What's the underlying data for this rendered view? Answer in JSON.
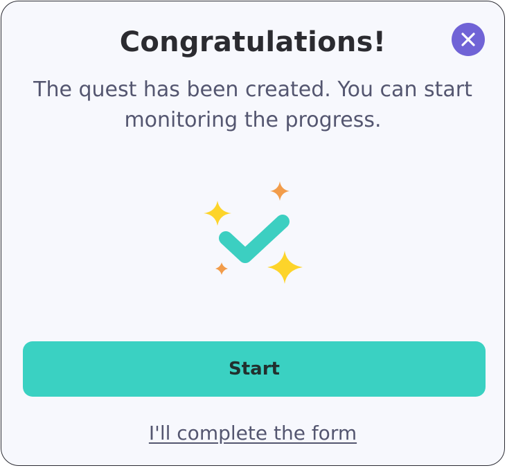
{
  "dialog": {
    "title": "Congratulations!",
    "message": "The quest has been created. You can start monitoring the progress.",
    "close_icon": "close-icon",
    "illustration_icon": "check-sparkles-icon",
    "primary_button_label": "Start",
    "secondary_link_label": "I'll complete the form"
  },
  "colors": {
    "modal_background": "#f7f8fd",
    "close_button": "#7063d6",
    "primary_button": "#3ad1c2",
    "check_mark": "#3ccfc1",
    "sparkle_yellow": "#fdd42a",
    "sparkle_orange": "#f29c4a",
    "title_text": "#2b2b30",
    "body_text": "#545670"
  }
}
